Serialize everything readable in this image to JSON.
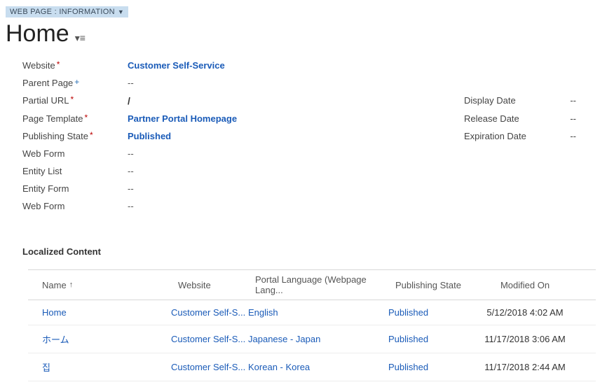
{
  "breadcrumb": {
    "label": "WEB PAGE : INFORMATION"
  },
  "title": "Home",
  "fields": {
    "website": {
      "label": "Website",
      "value": "Customer Self-Service",
      "required": "red"
    },
    "parentPage": {
      "label": "Parent Page",
      "value": "--",
      "required": "blue"
    },
    "partialUrl": {
      "label": "Partial URL",
      "value": "/",
      "required": "red"
    },
    "pageTemplate": {
      "label": "Page Template",
      "value": "Partner Portal Homepage",
      "required": "red"
    },
    "publishingState": {
      "label": "Publishing State",
      "value": "Published",
      "required": "red"
    },
    "webForm1": {
      "label": "Web Form",
      "value": "--"
    },
    "entityList": {
      "label": "Entity List",
      "value": "--"
    },
    "entityForm": {
      "label": "Entity Form",
      "value": "--"
    },
    "webForm2": {
      "label": "Web Form",
      "value": "--"
    }
  },
  "rightFields": {
    "displayDate": {
      "label": "Display Date",
      "value": "--"
    },
    "releaseDate": {
      "label": "Release Date",
      "value": "--"
    },
    "expirationDate": {
      "label": "Expiration Date",
      "value": "--"
    }
  },
  "section": {
    "header": "Localized Content"
  },
  "grid": {
    "columns": {
      "name": "Name",
      "website": "Website",
      "portalLang": "Portal Language (Webpage Lang...",
      "pubState": "Publishing State",
      "modifiedOn": "Modified On"
    },
    "rows": [
      {
        "name": "Home",
        "website": "Customer Self-S...",
        "lang": "English",
        "state": "Published",
        "modified": "5/12/2018 4:02 AM"
      },
      {
        "name": "ホーム",
        "website": "Customer Self-S...",
        "lang": "Japanese - Japan",
        "state": "Published",
        "modified": "11/17/2018 3:06 AM"
      },
      {
        "name": "집",
        "website": "Customer Self-S...",
        "lang": "Korean - Korea",
        "state": "Published",
        "modified": "11/17/2018 2:44 AM"
      }
    ]
  }
}
